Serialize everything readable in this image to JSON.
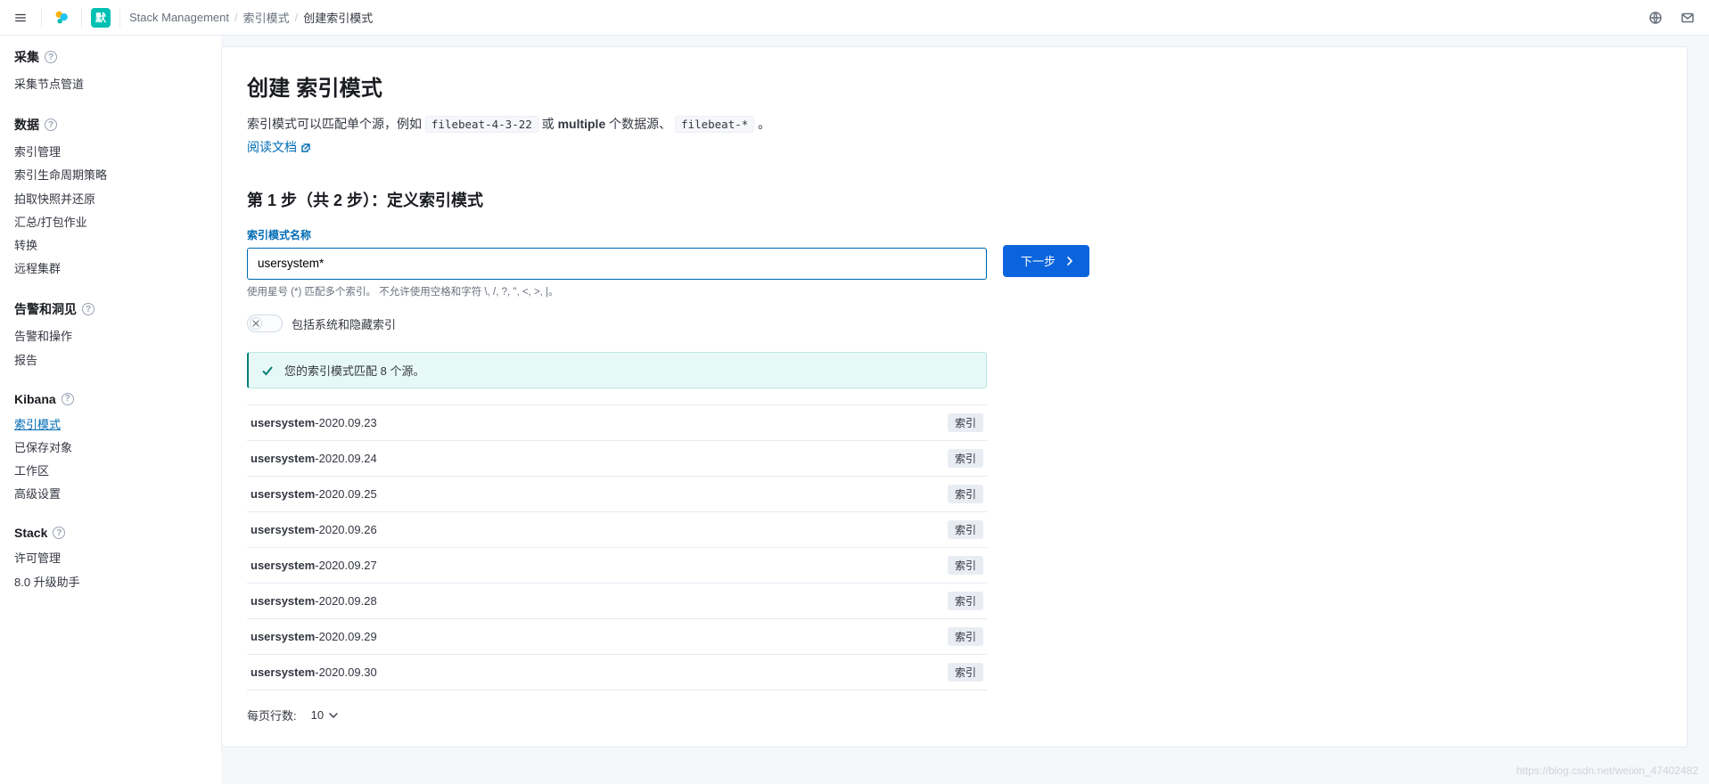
{
  "topbar": {
    "space_initial": "默",
    "breadcrumbs": [
      "Stack Management",
      "索引模式",
      "创建索引模式"
    ]
  },
  "sidebar": {
    "sections": [
      {
        "title": "采集",
        "items": [
          "采集节点管道"
        ]
      },
      {
        "title": "数据",
        "items": [
          "索引管理",
          "索引生命周期策略",
          "拍取快照并还原",
          "汇总/打包作业",
          "转换",
          "远程集群"
        ]
      },
      {
        "title": "告警和洞见",
        "items": [
          "告警和操作",
          "报告"
        ]
      },
      {
        "title": "Kibana",
        "items": [
          "索引模式",
          "已保存对象",
          "工作区",
          "高级设置"
        ],
        "active_index": 0
      },
      {
        "title": "Stack",
        "items": [
          "许可管理",
          "8.0 升级助手"
        ]
      }
    ]
  },
  "page": {
    "title": "创建 索引模式",
    "intro_prefix": "索引模式可以匹配单个源，例如 ",
    "intro_code1": "filebeat-4-3-22",
    "intro_mid": " 或 ",
    "intro_bold": "multiple",
    "intro_mid2": " 个数据源、 ",
    "intro_code2": "filebeat-*",
    "intro_suffix": " 。",
    "doc_link": "阅读文档",
    "step_title": "第 1 步（共 2 步）：定义索引模式",
    "field_label": "索引模式名称",
    "pattern_value": "usersystem*",
    "hint": "使用星号 (*) 匹配多个索引。 不允许使用空格和字符 \\, /, ?, \", <, >, |。",
    "next_btn": "下一步",
    "switch_label": "包括系统和隐藏索引",
    "callout_text": "您的索引模式匹配 8 个源。",
    "matches_prefix": "usersystem",
    "matches_tag": "索引",
    "matches": [
      "-2020.09.23",
      "-2020.09.24",
      "-2020.09.25",
      "-2020.09.26",
      "-2020.09.27",
      "-2020.09.28",
      "-2020.09.29",
      "-2020.09.30"
    ],
    "pager_label": "每页行数:",
    "pager_value": "10"
  },
  "watermark": "https://blog.csdn.net/weixin_47402482"
}
